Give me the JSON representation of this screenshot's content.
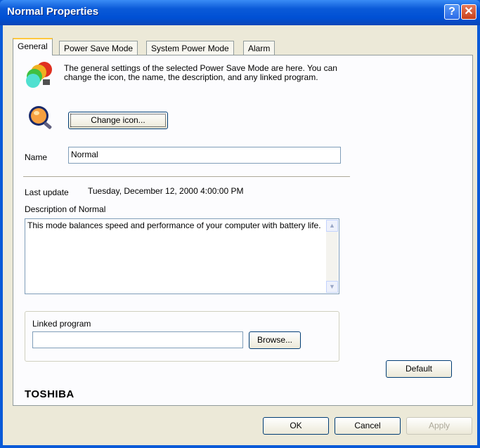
{
  "window": {
    "title": "Normal Properties",
    "help_label": "?",
    "close_label": "✕"
  },
  "tabs": [
    {
      "label": "General"
    },
    {
      "label": "Power Save Mode"
    },
    {
      "label": "System Power Mode"
    },
    {
      "label": "Alarm"
    }
  ],
  "general": {
    "intro": "The general settings of the selected Power Save Mode are here.  You can change the icon, the name, the description, and any linked program.",
    "change_icon_label": "Change icon...",
    "name_label": "Name",
    "name_value": "Normal",
    "last_update_label": "Last update",
    "last_update_value": "Tuesday, December 12, 2000 4:00:00 PM",
    "description_label": "Description of Normal",
    "description_value": "This mode balances speed and performance of your computer with battery life.",
    "linked_program_label": "Linked program",
    "linked_program_value": "",
    "browse_label": "Browse...",
    "default_label": "Default",
    "brand": "TOSHIBA"
  },
  "footer": {
    "ok_label": "OK",
    "cancel_label": "Cancel",
    "apply_label": "Apply"
  },
  "colors": {
    "titlebar": "#0a5ad8",
    "dialog_bg": "#ece9d8",
    "tab_highlight": "#ffc83c"
  }
}
